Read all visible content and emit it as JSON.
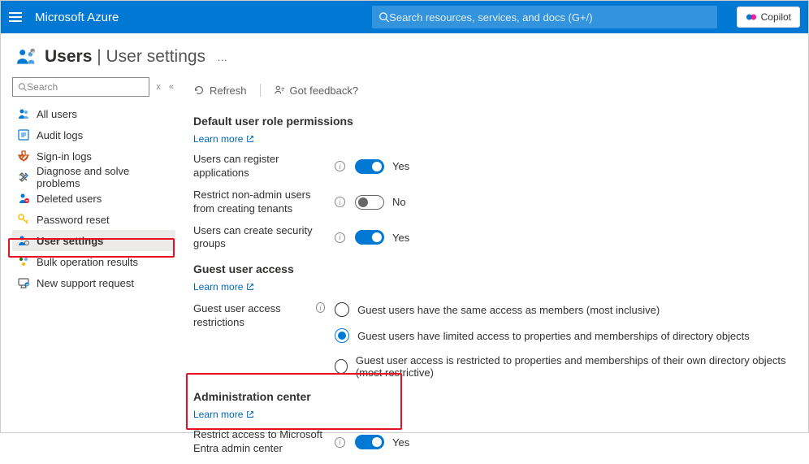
{
  "topbar": {
    "brand": "Microsoft Azure",
    "search_placeholder": "Search resources, services, and docs (G+/)",
    "copilot_label": "Copilot"
  },
  "page": {
    "title_bold": "Users",
    "title_sep": " | ",
    "title_thin": "User settings",
    "more": "…"
  },
  "sidebar": {
    "search_placeholder": "Search",
    "pin_label": "«",
    "x_label": "x",
    "items": [
      {
        "label": "All users",
        "color": "#0078d4"
      },
      {
        "label": "Audit logs",
        "color": "#0078d4"
      },
      {
        "label": "Sign-in logs",
        "color": "#ca5010"
      },
      {
        "label": "Diagnose and solve problems",
        "color": "#605e5c"
      },
      {
        "label": "Deleted users",
        "color": "#0078d4"
      },
      {
        "label": "Password reset",
        "color": "#ffb900"
      },
      {
        "label": "User settings",
        "color": "#0078d4"
      },
      {
        "label": "Bulk operation results",
        "color": "#107c10"
      },
      {
        "label": "New support request",
        "color": "#605e5c"
      }
    ]
  },
  "toolbar": {
    "refresh": "Refresh",
    "feedback": "Got feedback?"
  },
  "sections": {
    "default_permissions": {
      "title": "Default user role permissions",
      "learn": "Learn more",
      "rows": [
        {
          "label": "Users can register applications",
          "on": true,
          "value": "Yes"
        },
        {
          "label": "Restrict non-admin users from creating tenants",
          "on": false,
          "value": "No"
        },
        {
          "label": "Users can create security groups",
          "on": true,
          "value": "Yes"
        }
      ]
    },
    "guest_access": {
      "title": "Guest user access",
      "learn": "Learn more",
      "label": "Guest user access restrictions",
      "options": [
        {
          "label": "Guest users have the same access as members (most inclusive)",
          "checked": false
        },
        {
          "label": "Guest users have limited access to properties and memberships of directory objects",
          "checked": true
        },
        {
          "label": "Guest user access is restricted to properties and memberships of their own directory objects (most restrictive)",
          "checked": false
        }
      ]
    },
    "admin_center": {
      "title": "Administration center",
      "learn": "Learn more",
      "label": "Restrict access to Microsoft Entra admin center",
      "on": true,
      "value": "Yes"
    }
  }
}
